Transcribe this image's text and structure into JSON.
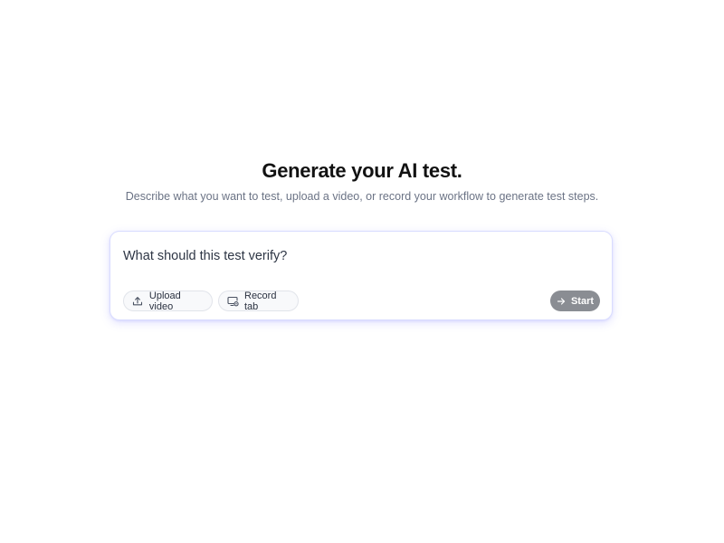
{
  "header": {
    "title": "Generate your AI test.",
    "subtitle": "Describe what you want to test, upload a video, or record your workflow to generate test steps."
  },
  "composer": {
    "placeholder": "What should this test verify?",
    "value": "",
    "actions": {
      "upload": {
        "label": "Upload video",
        "icon": "upload-icon"
      },
      "record": {
        "label": "Record tab",
        "icon": "record-tab-icon"
      }
    },
    "start": {
      "label": "Start",
      "icon": "arrow-right-icon",
      "state": "disabled"
    }
  },
  "colors": {
    "title": "#121212",
    "subtitle": "#6b7385",
    "card_border": "#d9dcff",
    "card_glow": "#7878ff",
    "chip_bg": "#f8f9fb",
    "chip_border": "#e1e4ea",
    "start_bg": "#8a8d93"
  }
}
